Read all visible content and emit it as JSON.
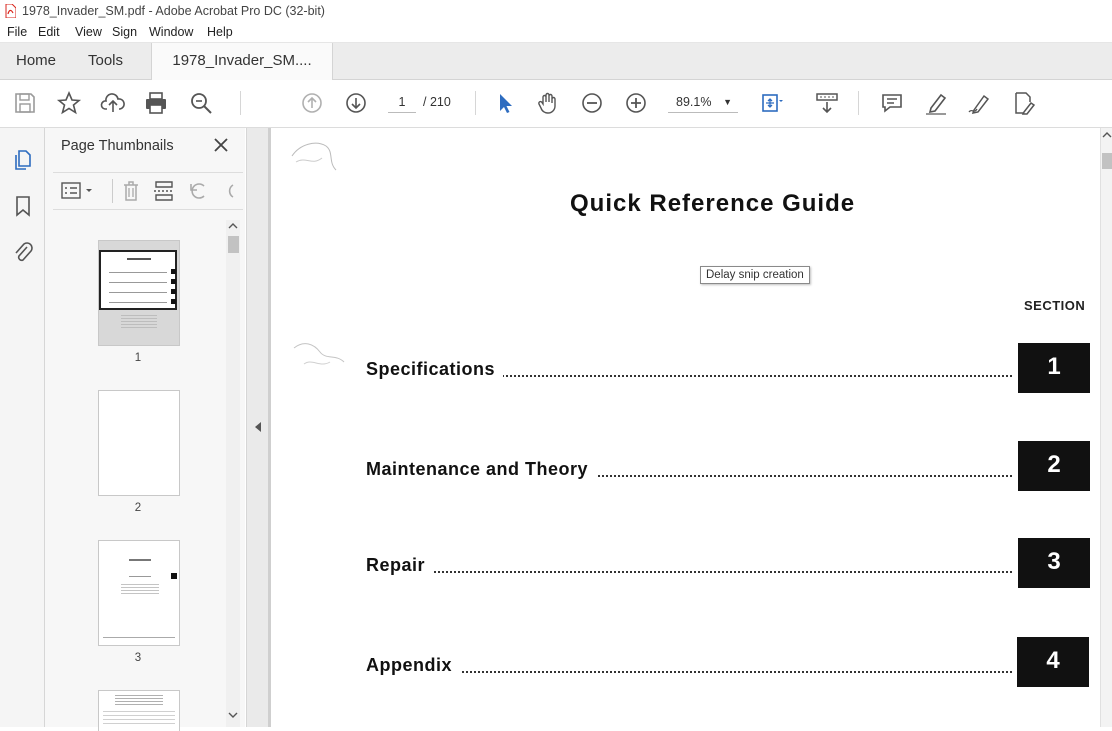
{
  "app": {
    "window_title": "1978_Invader_SM.pdf - Adobe Acrobat Pro DC (32-bit)",
    "menu": [
      {
        "label": "File"
      },
      {
        "label": "Edit"
      },
      {
        "label": "View"
      },
      {
        "label": "Sign"
      },
      {
        "label": "Window"
      },
      {
        "label": "Help"
      }
    ],
    "tabs": {
      "home": "Home",
      "tools": "Tools",
      "document": "1978_Invader_SM...."
    }
  },
  "toolbar": {
    "current_page": "1",
    "page_total": "/ 210",
    "zoom": "89.1%",
    "icons": [
      "save-icon",
      "bookmark-star-icon",
      "upload-icon",
      "print-icon",
      "search-zoom-icon",
      "prev-page-icon",
      "next-page-icon",
      "select-cursor-icon",
      "hand-icon",
      "zoom-out-icon",
      "zoom-in-icon",
      "fit-page-icon",
      "scroll-mode-icon",
      "comment-icon",
      "highlight-icon",
      "sign-icon",
      "edit-pdf-icon"
    ]
  },
  "thumbnails_panel": {
    "title": "Page Thumbnails",
    "pages": [
      {
        "number": "1"
      },
      {
        "number": "2"
      },
      {
        "number": "3"
      }
    ]
  },
  "document": {
    "heading": "Quick Reference Guide",
    "section_label": "SECTION",
    "entries": [
      {
        "label": "Specifications",
        "section": "1"
      },
      {
        "label": "Maintenance and Theory",
        "section": "2"
      },
      {
        "label": "Repair",
        "section": "3"
      },
      {
        "label": "Appendix",
        "section": "4"
      }
    ]
  },
  "tooltip": {
    "text": "Delay snip creation"
  },
  "colors": {
    "accent_blue": "#2d6cc0",
    "pdf_red": "#d9261c",
    "section_box": "#111111"
  }
}
